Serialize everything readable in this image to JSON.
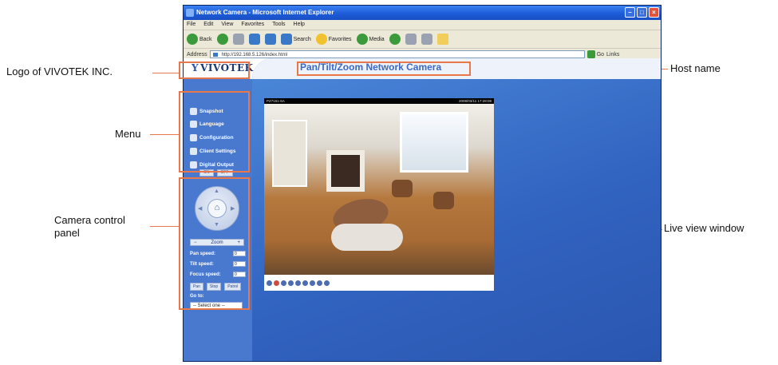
{
  "annotations": {
    "logo": "Logo of VIVOTEK INC.",
    "menu": "Menu",
    "camera_control": "Camera control panel",
    "host_name": "Host name",
    "live_view": "Live view window",
    "accent_color": "#e8784a"
  },
  "browser": {
    "title": "Network Camera - Microsoft Internet Explorer",
    "menus": [
      "File",
      "Edit",
      "View",
      "Favorites",
      "Tools",
      "Help"
    ],
    "toolbar": {
      "back": "Back",
      "search": "Search",
      "favorites": "Favorites",
      "media": "Media"
    },
    "address_label": "Address",
    "url": "http://192.168.5.126/index.html",
    "go": "Go",
    "links": "Links"
  },
  "camera_page": {
    "logo_text": "VIVOTEK",
    "host_name": "Pan/Tilt/Zoom Network Camera",
    "menu": [
      "Snapshot",
      "Language",
      "Configuration",
      "Client Settings",
      "Digital Output"
    ],
    "digital_output_buttons": [
      "ON",
      "OFF"
    ],
    "home_icon": "home-icon",
    "zoom_label": "Zoom",
    "pan_speed_label": "Pan speed:",
    "tilt_speed_label": "Tilt speed:",
    "focus_speed_label": "Focus speed:",
    "speed_value": "0",
    "pan_btn": "Pan",
    "stop_btn": "Stop",
    "patrol_btn": "Patrol",
    "goto_label": "Go to:",
    "goto_select": "-- Select one --",
    "video_caption": "PZ7151-6A",
    "video_timestamp": "2008/03/11 17:28:08",
    "brand_color": "#3d6fc8"
  }
}
